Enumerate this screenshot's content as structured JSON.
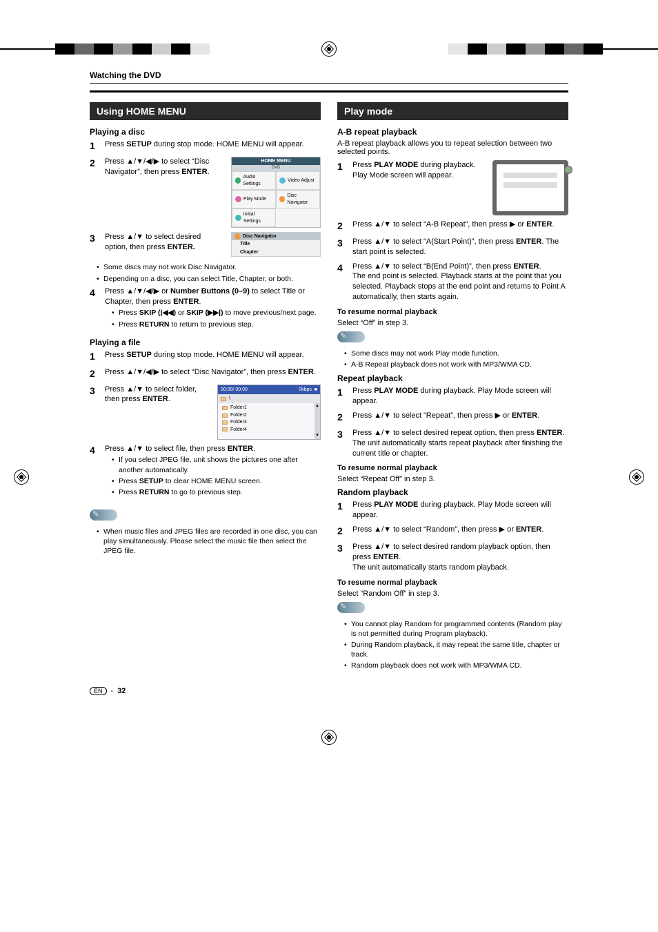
{
  "page": {
    "section": "Watching the DVD",
    "footer_lang": "EN",
    "footer_page": "32"
  },
  "left": {
    "panel": "Using HOME MENU",
    "s1": {
      "head": "Playing a disc",
      "n1": "Press SETUP during stop mode. HOME MENU will appear.",
      "n2": "Press ▲/▼/◀/▶ to select “Disc Navigator”, then press ENTER.",
      "n3": "Press ▲/▼ to select desired option, then press ENTER.",
      "n3_b1": "Some discs may not work Disc Navigator.",
      "n3_b2": "Depending on a disc, you can select Title, Chapter, or both.",
      "n4": "Press ▲/▼/◀/▶ or Number Buttons (0–9) to select Title or Chapter, then press ENTER.",
      "n4_b1": "Press SKIP (|◀◀) or SKIP (▶▶|) to move previous/next page.",
      "n4_b2": "Press RETURN to return to previous step."
    },
    "s2": {
      "head": "Playing a file",
      "n1": "Press SETUP during stop mode. HOME MENU will appear.",
      "n2": "Press ▲/▼/◀/▶ to select “Disc Navigator”, then press ENTER.",
      "n3": "Press ▲/▼ to select folder, then press ENTER.",
      "n4": "Press ▲/▼ to select file, then press ENTER.",
      "n4_b1": "If you select JPEG file, unit shows the pictures one after another automatically.",
      "n4_b2": "Press SETUP to clear HOME MENU screen.",
      "n4_b3": "Press RETURN to go to previous step.",
      "note1": "When music files and JPEG files are recorded in one disc, you can play simultaneously. Please select the music file then select the JPEG file."
    },
    "fig_home": {
      "title": "HOME MENU",
      "sub": "DVD",
      "c1": "Audio Settings",
      "c2": "Video Adjust",
      "c3": "Play Mode",
      "c4": "Disc Navigator",
      "c5": "Initial Settings"
    },
    "fig_dn": {
      "head": "Disc Navigator",
      "r1": "Title",
      "r2": "Chapter"
    },
    "fig_folder": {
      "toptime": "00:00/ 00:00",
      "topk": "0kbps",
      "root": "\\",
      "f1": "Folder1",
      "f2": "Folder2",
      "f3": "Folder3",
      "f4": "Folder4"
    }
  },
  "right": {
    "panel": "Play mode",
    "ab": {
      "head": "A-B repeat playback",
      "desc": "A-B repeat playback allows you to repeat selection between two selected points.",
      "n1": "Press PLAY MODE during playback. Play Mode screen will appear.",
      "n2": "Press ▲/▼ to select “A-B Repeat”, then press ▶ or ENTER.",
      "n3": "Press ▲/▼ to select “A(Start Point)”, then press ENTER. The start point is selected.",
      "n4": "Press ▲/▼ to select “B(End Point)”, then press ENTER.",
      "n4_desc": "The end point is selected. Playback starts at the point that you selected. Playback stops at the end point and returns to Point A automatically, then starts again.",
      "resume_h": "To resume normal playback",
      "resume_t": "Select “Off” in step 3.",
      "note1": "Some discs may not work Play mode function.",
      "note2": "A-B Repeat playback does not work with MP3/WMA CD."
    },
    "rep": {
      "head": "Repeat playback",
      "n1": "Press PLAY MODE during playback. Play Mode screen will appear.",
      "n2": "Press ▲/▼ to select “Repeat”, then press ▶ or ENTER.",
      "n3": "Press ▲/▼ to select desired repeat option, then press ENTER.",
      "n3_desc": "The unit automatically starts repeat playback after finishing the current title or chapter.",
      "resume_h": "To resume normal playback",
      "resume_t": "Select “Repeat Off” in step 3."
    },
    "rnd": {
      "head": "Random playback",
      "n1": "Press PLAY MODE during playback. Play Mode screen will appear.",
      "n2": "Press ▲/▼ to select “Random”, then press ▶ or ENTER.",
      "n3": "Press ▲/▼ to select desired random playback option, then press ENTER.",
      "n3_desc": "The unit automatically starts random playback.",
      "resume_h": "To resume normal playback",
      "resume_t": "Select “Random Off” in step 3.",
      "note1": "You cannot play Random for programmed contents (Random play is not permitted during Program playback).",
      "note2": "During Random playback, it may repeat the same title, chapter or track.",
      "note3": "Random playback does not work with MP3/WMA CD."
    }
  }
}
